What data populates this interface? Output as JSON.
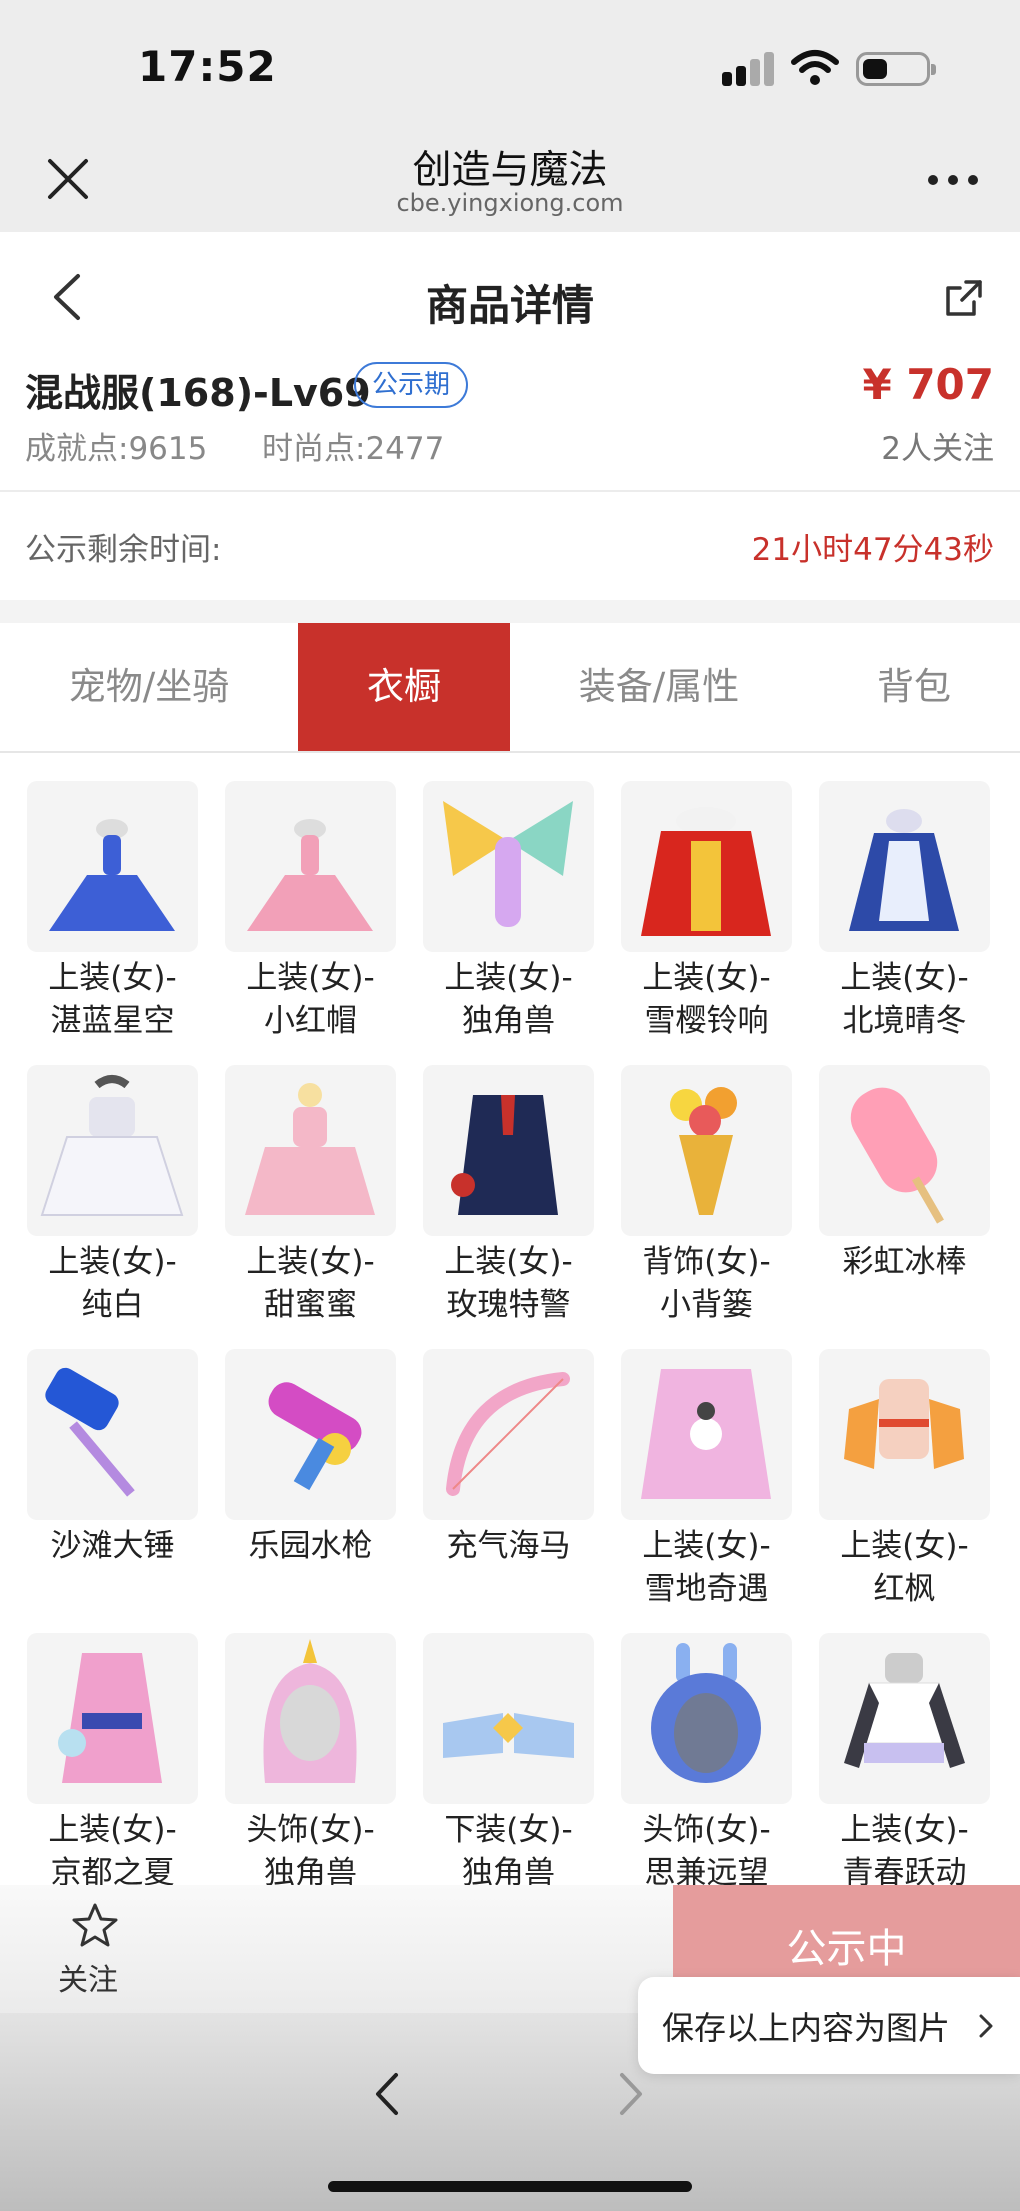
{
  "status_bar": {
    "time": "17:52"
  },
  "browser": {
    "title": "创造与魔法",
    "url": "cbe.yingxiong.com",
    "close_icon": "close-icon",
    "more_icon": "more-dots-icon"
  },
  "header": {
    "title": "商品详情",
    "back_icon": "chevron-left-icon",
    "share_icon": "share-icon"
  },
  "product": {
    "name": "混战服(168)-Lv69",
    "badge": "公示期",
    "price": "¥ 707",
    "achievement": "成就点:9615",
    "fashion": "时尚点:2477",
    "followers": "2人关注"
  },
  "countdown": {
    "label": "公示剩余时间:",
    "value": "21小时47分43秒"
  },
  "tabs": [
    {
      "label": "宠物/坐骑",
      "active": false
    },
    {
      "label": "衣橱",
      "active": true
    },
    {
      "label": "装备/属性",
      "active": false
    },
    {
      "label": "背包",
      "active": false
    }
  ],
  "items": [
    {
      "name": "上装(女)-\n湛蓝星空",
      "color": "#3d5fd6"
    },
    {
      "name": "上装(女)-\n小红帽",
      "color": "#f2a0b8"
    },
    {
      "name": "上装(女)-\n独角兽",
      "color": "#d6a8f0"
    },
    {
      "name": "上装(女)-\n雪樱铃响",
      "color": "#d8261e"
    },
    {
      "name": "上装(女)-\n北境晴冬",
      "color": "#2d4aa8"
    },
    {
      "name": "上装(女)-\n纯白",
      "color": "#f5f5fa"
    },
    {
      "name": "上装(女)-\n甜蜜蜜",
      "color": "#f4b8c8"
    },
    {
      "name": "上装(女)-\n玫瑰特警",
      "color": "#1f2a55"
    },
    {
      "name": "背饰(女)-\n小背篓",
      "color": "#e9b23a"
    },
    {
      "name": "彩虹冰棒",
      "color": "#ff9fb6"
    },
    {
      "name": "沙滩大锤",
      "color": "#2457d6"
    },
    {
      "name": "乐园水枪",
      "color": "#d44cc4"
    },
    {
      "name": "充气海马",
      "color": "#f2a6c8"
    },
    {
      "name": "上装(女)-\n雪地奇遇",
      "color": "#f0b4e0"
    },
    {
      "name": "上装(女)-\n红枫",
      "color": "#f5d0c0"
    },
    {
      "name": "上装(女)-\n京都之夏",
      "color": "#f0a0cc"
    },
    {
      "name": "头饰(女)-\n独角兽",
      "color": "#eeb6dc"
    },
    {
      "name": "下装(女)-\n独角兽",
      "color": "#a8c8f0"
    },
    {
      "name": "头饰(女)-\n思兼远望",
      "color": "#5a7ad8"
    },
    {
      "name": "上装(女)-\n青春跃动",
      "color": "#3a3a44"
    }
  ],
  "bottom_bar": {
    "follow_label": "关注",
    "follow_icon": "star-outline-icon",
    "action_label": "公示中"
  },
  "save_popup": {
    "label": "保存以上内容为图片"
  },
  "nav": {
    "back_icon": "nav-back-icon",
    "forward_icon": "nav-forward-icon"
  }
}
